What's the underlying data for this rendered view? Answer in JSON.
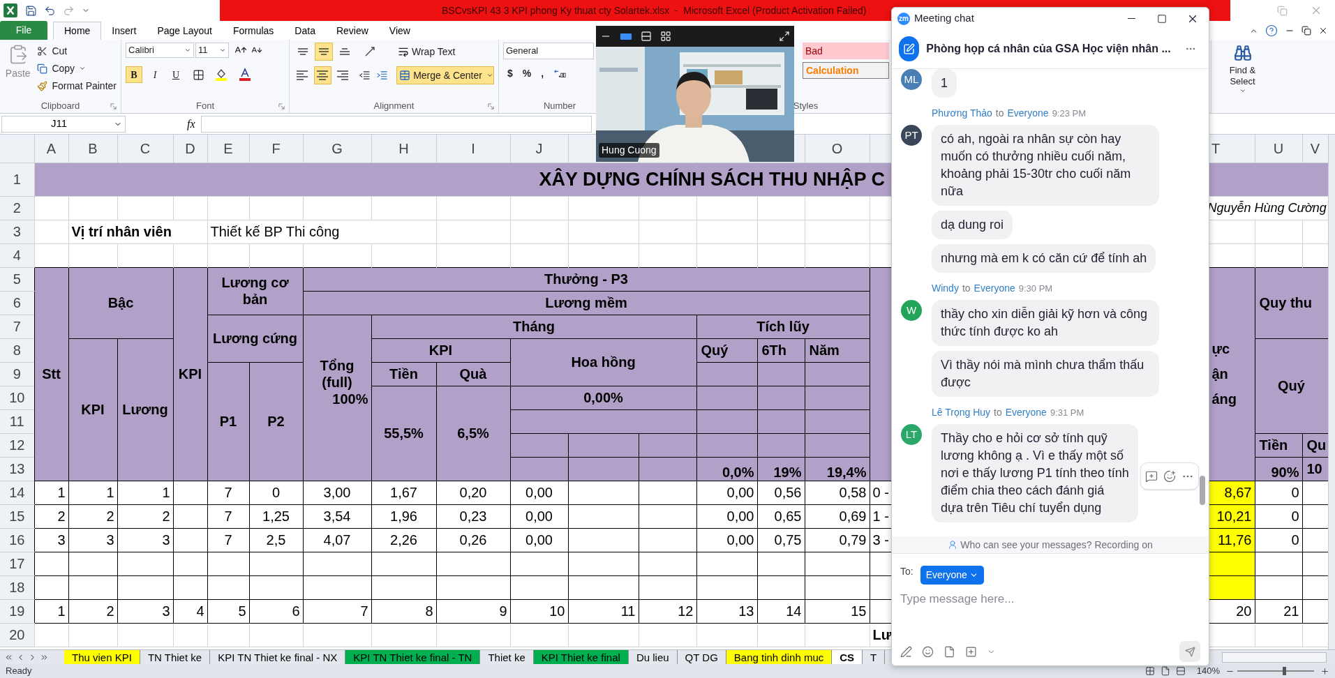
{
  "excel": {
    "window_title": "BSCvsKPI 43 3 KPI phong Ky thuat cty Solartek.xlsx  -  Microsoft Excel (Product Activation Failed)",
    "ribbon_tabs": [
      {
        "label": "File",
        "kind": "file",
        "selected": false
      },
      {
        "label": "Home",
        "kind": "tab",
        "selected": true
      },
      {
        "label": "Insert",
        "kind": "tab",
        "selected": false
      },
      {
        "label": "Page Layout",
        "kind": "tab",
        "selected": false
      },
      {
        "label": "Formulas",
        "kind": "tab",
        "selected": false
      },
      {
        "label": "Data",
        "kind": "tab",
        "selected": false
      },
      {
        "label": "Review",
        "kind": "tab",
        "selected": false
      },
      {
        "label": "View",
        "kind": "tab",
        "selected": false
      }
    ],
    "clipboard": {
      "paste": "Paste",
      "cut": "Cut",
      "copy": "Copy",
      "format_painter": "Format Painter",
      "label": "Clipboard"
    },
    "font": {
      "family": "Calibri",
      "size": "11",
      "styles": [
        {
          "label": "B",
          "kind": "bold",
          "on": true
        },
        {
          "label": "I",
          "kind": "italic",
          "on": false
        },
        {
          "label": "U",
          "kind": "underline",
          "on": false
        }
      ],
      "label": "Font"
    },
    "alignment": {
      "vertical": [
        {
          "kind": "top",
          "selected": false
        },
        {
          "kind": "middle",
          "selected": true
        },
        {
          "kind": "bottom",
          "selected": false
        }
      ],
      "horizontal": [
        {
          "kind": "left",
          "selected": false
        },
        {
          "kind": "center",
          "selected": true
        },
        {
          "kind": "right",
          "selected": false
        }
      ],
      "wrap_text": {
        "label": "Wrap Text",
        "on": false
      },
      "merge": {
        "label": "Merge & Center",
        "on": true
      },
      "label": "Alignment"
    },
    "number": {
      "format": "General",
      "symbols": [
        "$",
        "%",
        ","
      ],
      "label": "Number"
    },
    "styles": {
      "cells": [
        {
          "label": "Bad",
          "kind": "bad"
        },
        {
          "label": "Calculation",
          "kind": "calculation"
        }
      ],
      "label": "Styles"
    },
    "editing": {
      "find_select": "Find & Select"
    },
    "name_box": "J11",
    "function_symbol": "fx",
    "sheet": {
      "column_headers": [
        "A",
        "B",
        "C",
        "D",
        "E",
        "F",
        "G",
        "H",
        "I",
        "J",
        "O",
        "T",
        "U",
        "V"
      ],
      "row_headers": [
        "1",
        "2",
        "3",
        "4",
        "5",
        "6",
        "7",
        "8",
        "9",
        "10",
        "11",
        "12",
        "13",
        "14",
        "15",
        "16",
        "17",
        "18",
        "19",
        "20"
      ],
      "title": "XÂY DỰNG CHÍNH SÁCH THU NHẬP C",
      "author": "Nguyễn Hùng Cường",
      "position": {
        "label": "Vị trí nhân viên",
        "value": "Thiết kế BP Thi công"
      },
      "header_cells": [
        "Stt",
        "Bậc",
        "KPI",
        "Lương cơ bản",
        "Thưởng - P3",
        "ực\nận\náng",
        "Lương mềm",
        "Quy thu",
        "Lương cứng",
        "Tổng\n(full)",
        "100%",
        "Tháng",
        "Tích lũy",
        "KPI",
        "Lương",
        "KPI",
        "Hoa hồng",
        "Quý",
        "6Th",
        "Năm",
        "Quý",
        "P1",
        "P2",
        "Tiền",
        "Quà",
        "55,5%",
        "6,5%",
        "0,00%",
        "Tiền",
        "Qu",
        "0,0%",
        "19%",
        "19,4%",
        "90%",
        "10"
      ],
      "rows": [
        {
          "kind": "data",
          "highlighted": true,
          "cells": {
            "A": "1",
            "B": "1",
            "C": "1",
            "E": "7",
            "F": "0",
            "G": "3,00",
            "H": "1,67",
            "I": "0,20",
            "J": "0,00",
            "M": "0,00",
            "N": "0,56",
            "O": "0,58",
            "P": "0 -",
            "T": "8,67",
            "U": "0"
          }
        },
        {
          "kind": "data",
          "highlighted": true,
          "cells": {
            "A": "2",
            "B": "2",
            "C": "2",
            "E": "7",
            "F": "1,25",
            "G": "3,54",
            "H": "1,96",
            "I": "0,23",
            "J": "0,00",
            "M": "0,00",
            "N": "0,65",
            "O": "0,69",
            "P": "1 -",
            "T": "10,21",
            "U": "0"
          }
        },
        {
          "kind": "data",
          "highlighted": true,
          "cells": {
            "A": "3",
            "B": "3",
            "C": "3",
            "E": "7",
            "F": "2,5",
            "G": "4,07",
            "H": "2,26",
            "I": "0,26",
            "J": "0,00",
            "M": "0,00",
            "N": "0,75",
            "O": "0,79",
            "P": "3 -",
            "T": "11,76",
            "U": "0"
          }
        },
        {
          "kind": "data",
          "highlighted": true
        },
        {
          "kind": "data",
          "highlighted": true
        },
        {
          "kind": "index",
          "highlighted": false,
          "cells": {
            "A": "1",
            "B": "2",
            "C": "3",
            "D": "4",
            "E": "5",
            "F": "6",
            "G": "7",
            "H": "8",
            "I": "9",
            "J": "10",
            "K": "11",
            "L": "12",
            "M": "13",
            "N": "14",
            "O": "15",
            "T": "20",
            "U": "21"
          }
        },
        {
          "kind": "note",
          "highlighted": false,
          "cells": {
            "P": "Lư"
          }
        }
      ]
    },
    "sheet_tabs": [
      {
        "label": "Thu vien KPI",
        "color": "#ffff00",
        "selected": false
      },
      {
        "label": "TN Thiet ke",
        "selected": false
      },
      {
        "label": "KPI TN Thiet ke final - NX",
        "selected": false
      },
      {
        "label": "KPI TN Thiet ke final - TN",
        "color": "#00b050",
        "selected": false
      },
      {
        "label": "Thiet ke",
        "selected": false
      },
      {
        "label": "KPI Thiet ke final",
        "color": "#00b050",
        "selected": false
      },
      {
        "label": "Du lieu",
        "selected": false
      },
      {
        "label": "QT DG",
        "selected": false
      },
      {
        "label": "Bang tinh dinh muc",
        "color": "#ffff00",
        "selected": false
      },
      {
        "label": "CS",
        "selected": true
      },
      {
        "label": "T",
        "selected": false
      }
    ],
    "status": {
      "text": "Ready",
      "zoom": "140%",
      "zoom_slider": {
        "level": 0.59
      }
    }
  },
  "video": {
    "participant": "Hung Cuong",
    "layouts": [
      {
        "kind": "speaker",
        "selected": true
      },
      {
        "kind": "stack",
        "selected": false
      },
      {
        "kind": "grid",
        "selected": false
      }
    ]
  },
  "chat": {
    "app_badge": "zm",
    "window_title": "Meeting chat",
    "room": "Phòng họp cá nhân của GSA Học viện nhân ...",
    "groups": [
      {
        "avatar": "ML",
        "color": "#4a7fb5",
        "hovered": false,
        "messages": [
          "1"
        ]
      },
      {
        "sender": "Phương Thảo",
        "to_word": "to",
        "recipient": "Everyone",
        "time": "9:23 PM",
        "avatar": "PT",
        "color": "#3a4659",
        "hovered": false,
        "messages": [
          "có ah, ngoài ra nhân sự còn hay muốn có thưởng nhiều cuối năm, khoảng phải 15-30tr cho cuối năm nữa",
          "dạ dung roi",
          "nhưng mà em k có căn cứ để tính ah"
        ]
      },
      {
        "sender": "Windy",
        "to_word": "to",
        "recipient": "Everyone",
        "time": "9:30 PM",
        "avatar": "W",
        "color": "#22a45a",
        "hovered": false,
        "messages": [
          "thầy cho xin diễn giải kỹ hơn và công thức tính được ko ah",
          "Vì thầy nói mà mình chưa thẩm thấu được"
        ]
      },
      {
        "sender": "Lê Trọng Huy",
        "to_word": "to",
        "recipient": "Everyone",
        "time": "9:31 PM",
        "avatar": "LT",
        "color": "#2aa86a",
        "hovered": true,
        "messages": [
          "Thầy cho e hỏi cơ sở tính quỹ lương không ạ  . Vì e thấy một số nơi e thấy lương P1 tính theo tính điểm chia theo cách đánh giá dựa trên Tiêu chí tuyển dụng"
        ]
      }
    ],
    "privacy_note": "Who can see your messages? Recording on",
    "to_label": "To:",
    "recipient_button": "Everyone",
    "placeholder": "Type message here..."
  }
}
